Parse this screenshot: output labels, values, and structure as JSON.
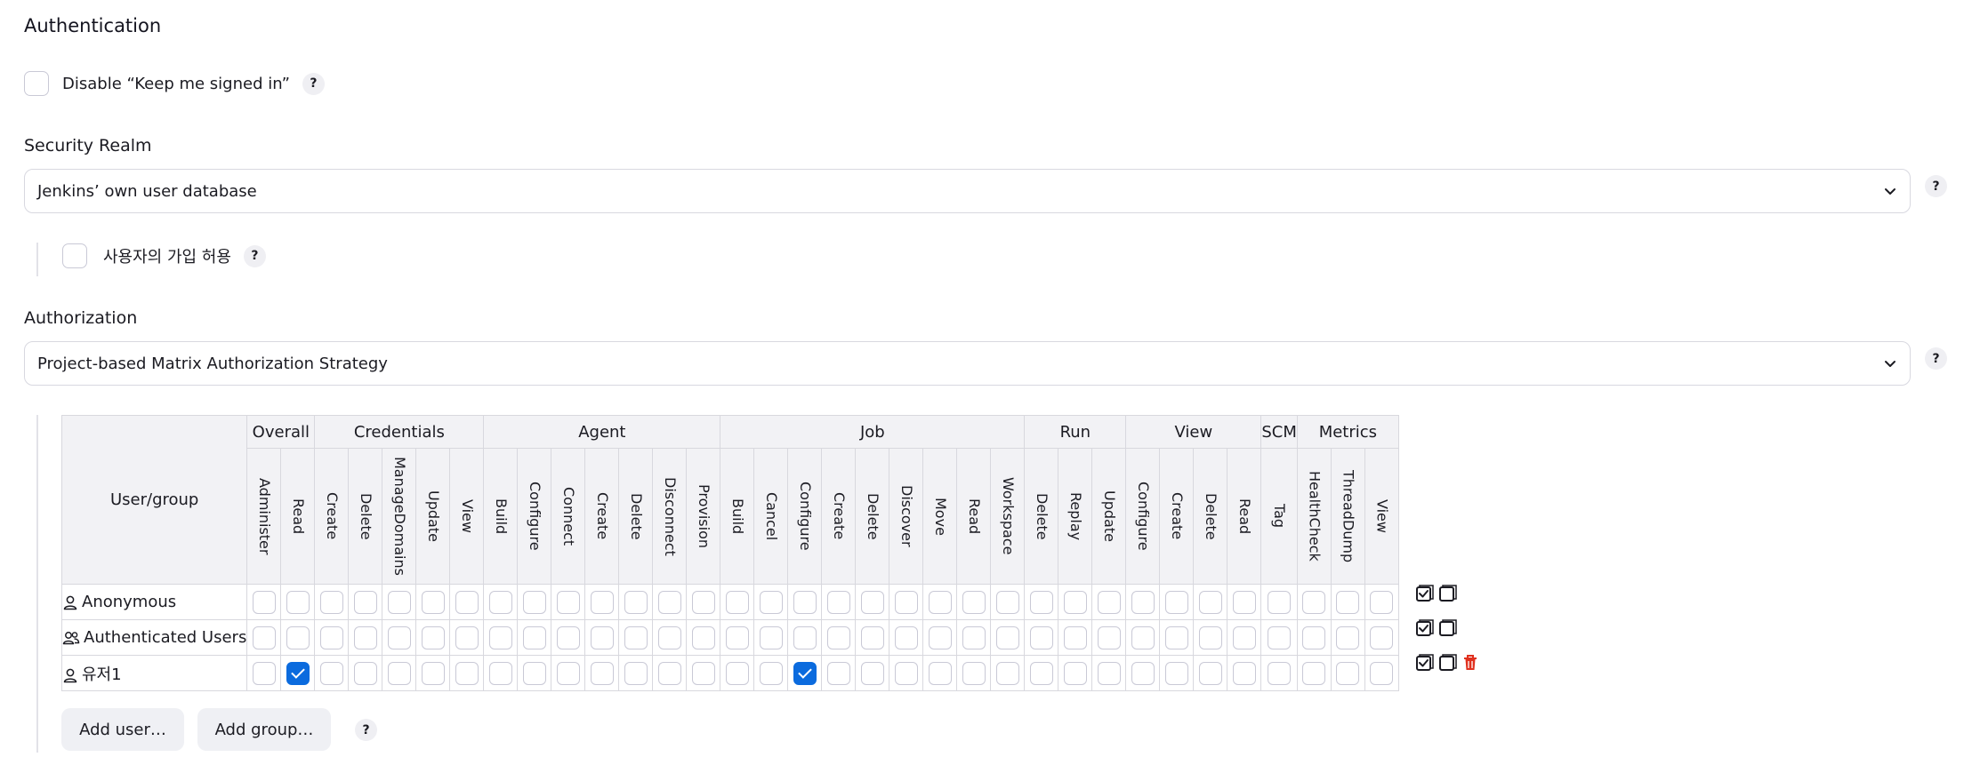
{
  "section": {
    "title": "Authentication"
  },
  "keep_signed_in": {
    "label": "Disable “Keep me signed in”",
    "checked": false
  },
  "security_realm": {
    "label": "Security Realm",
    "selected": "Jenkins’ own user database",
    "allow_signup": {
      "label": "사용자의 가입 허용",
      "checked": false
    }
  },
  "authorization": {
    "label": "Authorization",
    "selected": "Project-based Matrix Authorization Strategy"
  },
  "help_label": "?",
  "matrix": {
    "user_group_header": "User/group",
    "groups": [
      {
        "name": "Overall",
        "perms": [
          "Administer",
          "Read"
        ]
      },
      {
        "name": "Credentials",
        "perms": [
          "Create",
          "Delete",
          "ManageDomains",
          "Update",
          "View"
        ]
      },
      {
        "name": "Agent",
        "perms": [
          "Build",
          "Configure",
          "Connect",
          "Create",
          "Delete",
          "Disconnect",
          "Provision"
        ]
      },
      {
        "name": "Job",
        "perms": [
          "Build",
          "Cancel",
          "Configure",
          "Create",
          "Delete",
          "Discover",
          "Move",
          "Read",
          "Workspace"
        ]
      },
      {
        "name": "Run",
        "perms": [
          "Delete",
          "Replay",
          "Update"
        ]
      },
      {
        "name": "View",
        "perms": [
          "Configure",
          "Create",
          "Delete",
          "Read"
        ]
      },
      {
        "name": "SCM",
        "perms": [
          "Tag"
        ]
      },
      {
        "name": "Metrics",
        "perms": [
          "HealthCheck",
          "ThreadDump",
          "View"
        ]
      }
    ],
    "rows": [
      {
        "name": "Anonymous",
        "icon": "user-icon",
        "checked": [],
        "deletable": false
      },
      {
        "name": "Authenticated Users",
        "icon": "users-group-icon",
        "checked": [],
        "deletable": false
      },
      {
        "name": "유저1",
        "icon": "user-icon",
        "checked": [
          1,
          16
        ],
        "deletable": true
      }
    ]
  },
  "buttons": {
    "add_user": "Add user…",
    "add_group": "Add group…"
  },
  "colors": {
    "accent": "#0b6bde",
    "delete": "#e0301e"
  }
}
